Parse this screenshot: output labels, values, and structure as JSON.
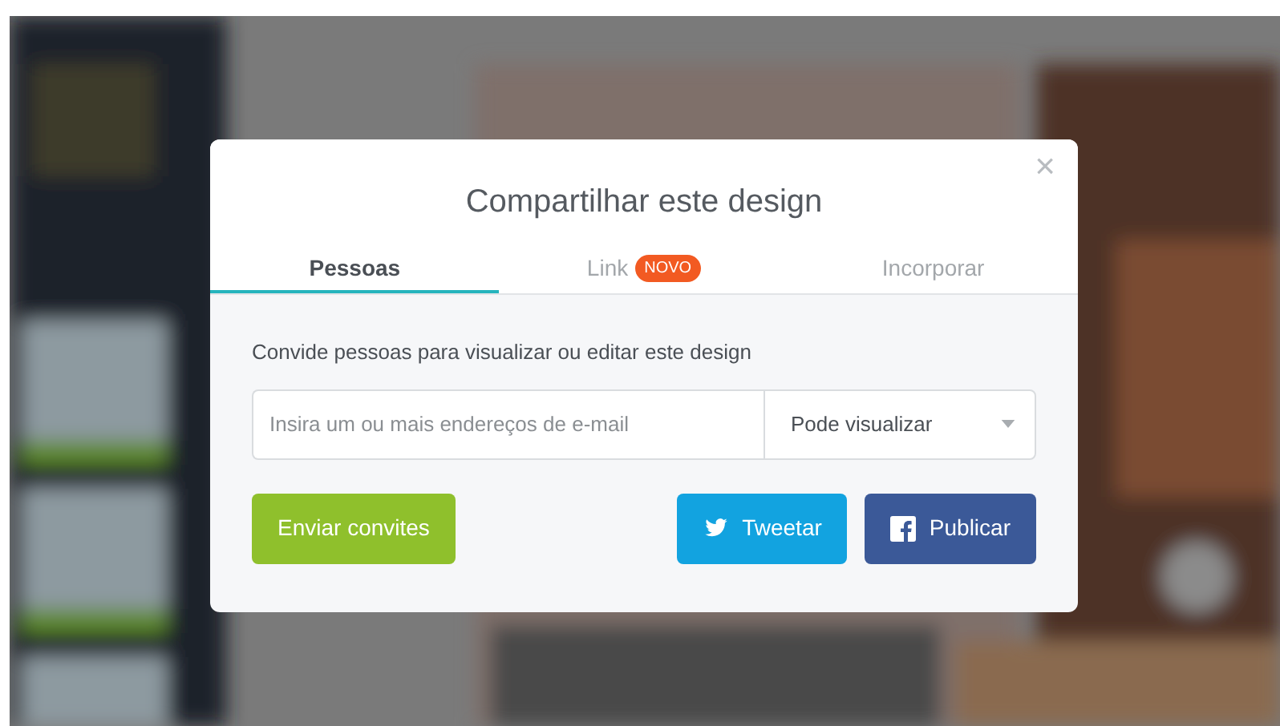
{
  "dialog": {
    "title": "Compartilhar este design",
    "close": "×"
  },
  "tabs": [
    {
      "label": "Pessoas",
      "selected": true
    },
    {
      "label": "Link",
      "selected": false,
      "badge": "NOVO"
    },
    {
      "label": "Incorporar",
      "selected": false
    }
  ],
  "invite": {
    "text": "Convide pessoas para visualizar ou editar este design",
    "email": {
      "placeholder": "Insira um ou mais endereços de e-mail"
    },
    "permission": "Pode visualizar"
  },
  "buttons": [
    {
      "kind": "send",
      "label": "Enviar convites"
    },
    {
      "kind": "twitter",
      "label": "Tweetar"
    },
    {
      "kind": "facebook",
      "label": "Publicar"
    }
  ]
}
